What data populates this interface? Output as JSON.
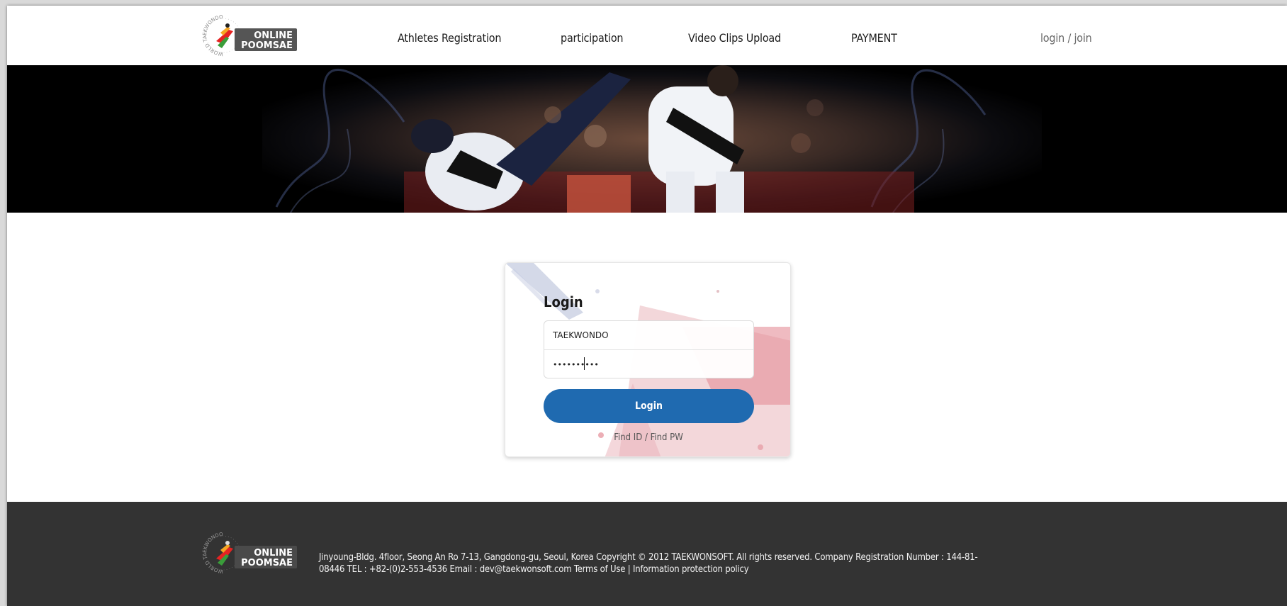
{
  "header": {
    "logo": {
      "icon": "online-poomsae-logo",
      "ring_text": "WORLD TAEKWONDO",
      "line1": "ONLINE",
      "line2": "POOMSAE"
    },
    "nav": [
      {
        "label": "Athletes Registration"
      },
      {
        "label": "participation"
      },
      {
        "label": "Video Clips Upload"
      },
      {
        "label": "PAYMENT"
      }
    ],
    "auth_link": "login / join"
  },
  "banner": {
    "image": "taekwondo-kick-photo"
  },
  "login": {
    "title": "Login",
    "id_value": "TAEKWONDO",
    "password_masked": "••••••••••",
    "submit_label": "Login",
    "find_link": "Find ID / Find PW"
  },
  "footer": {
    "address": "Jinyoung-Bldg. 4floor, Seong An Ro 7-13, Gangdong-gu, Seoul, Korea",
    "copyright": "Copyright © 2012 TAEKWONSOFT. All rights reserved.",
    "registration": "Company Registration Number : 144-81-08446",
    "tel": "TEL : +82-(0)2-553-4536",
    "email": "Email : dev@taekwonsoft.com",
    "terms": "Terms of Use",
    "separator": "|",
    "privacy": "Information protection policy"
  },
  "colors": {
    "accent": "#1f6ab0",
    "footer_bg": "#333333",
    "logo_badge": "#555555"
  }
}
